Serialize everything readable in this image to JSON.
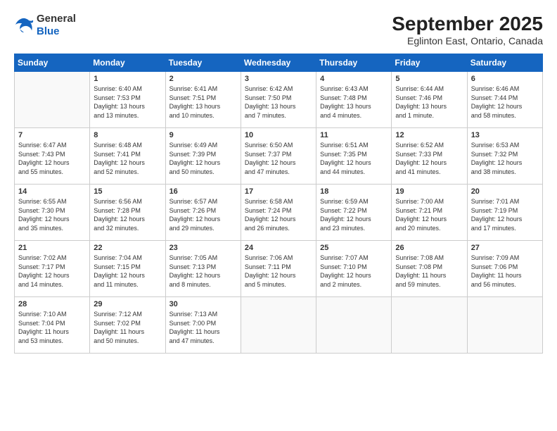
{
  "header": {
    "logo_general": "General",
    "logo_blue": "Blue",
    "title": "September 2025",
    "subtitle": "Eglinton East, Ontario, Canada"
  },
  "weekdays": [
    "Sunday",
    "Monday",
    "Tuesday",
    "Wednesday",
    "Thursday",
    "Friday",
    "Saturday"
  ],
  "weeks": [
    [
      {
        "day": "",
        "info": ""
      },
      {
        "day": "1",
        "info": "Sunrise: 6:40 AM\nSunset: 7:53 PM\nDaylight: 13 hours\nand 13 minutes."
      },
      {
        "day": "2",
        "info": "Sunrise: 6:41 AM\nSunset: 7:51 PM\nDaylight: 13 hours\nand 10 minutes."
      },
      {
        "day": "3",
        "info": "Sunrise: 6:42 AM\nSunset: 7:50 PM\nDaylight: 13 hours\nand 7 minutes."
      },
      {
        "day": "4",
        "info": "Sunrise: 6:43 AM\nSunset: 7:48 PM\nDaylight: 13 hours\nand 4 minutes."
      },
      {
        "day": "5",
        "info": "Sunrise: 6:44 AM\nSunset: 7:46 PM\nDaylight: 13 hours\nand 1 minute."
      },
      {
        "day": "6",
        "info": "Sunrise: 6:46 AM\nSunset: 7:44 PM\nDaylight: 12 hours\nand 58 minutes."
      }
    ],
    [
      {
        "day": "7",
        "info": "Sunrise: 6:47 AM\nSunset: 7:43 PM\nDaylight: 12 hours\nand 55 minutes."
      },
      {
        "day": "8",
        "info": "Sunrise: 6:48 AM\nSunset: 7:41 PM\nDaylight: 12 hours\nand 52 minutes."
      },
      {
        "day": "9",
        "info": "Sunrise: 6:49 AM\nSunset: 7:39 PM\nDaylight: 12 hours\nand 50 minutes."
      },
      {
        "day": "10",
        "info": "Sunrise: 6:50 AM\nSunset: 7:37 PM\nDaylight: 12 hours\nand 47 minutes."
      },
      {
        "day": "11",
        "info": "Sunrise: 6:51 AM\nSunset: 7:35 PM\nDaylight: 12 hours\nand 44 minutes."
      },
      {
        "day": "12",
        "info": "Sunrise: 6:52 AM\nSunset: 7:33 PM\nDaylight: 12 hours\nand 41 minutes."
      },
      {
        "day": "13",
        "info": "Sunrise: 6:53 AM\nSunset: 7:32 PM\nDaylight: 12 hours\nand 38 minutes."
      }
    ],
    [
      {
        "day": "14",
        "info": "Sunrise: 6:55 AM\nSunset: 7:30 PM\nDaylight: 12 hours\nand 35 minutes."
      },
      {
        "day": "15",
        "info": "Sunrise: 6:56 AM\nSunset: 7:28 PM\nDaylight: 12 hours\nand 32 minutes."
      },
      {
        "day": "16",
        "info": "Sunrise: 6:57 AM\nSunset: 7:26 PM\nDaylight: 12 hours\nand 29 minutes."
      },
      {
        "day": "17",
        "info": "Sunrise: 6:58 AM\nSunset: 7:24 PM\nDaylight: 12 hours\nand 26 minutes."
      },
      {
        "day": "18",
        "info": "Sunrise: 6:59 AM\nSunset: 7:22 PM\nDaylight: 12 hours\nand 23 minutes."
      },
      {
        "day": "19",
        "info": "Sunrise: 7:00 AM\nSunset: 7:21 PM\nDaylight: 12 hours\nand 20 minutes."
      },
      {
        "day": "20",
        "info": "Sunrise: 7:01 AM\nSunset: 7:19 PM\nDaylight: 12 hours\nand 17 minutes."
      }
    ],
    [
      {
        "day": "21",
        "info": "Sunrise: 7:02 AM\nSunset: 7:17 PM\nDaylight: 12 hours\nand 14 minutes."
      },
      {
        "day": "22",
        "info": "Sunrise: 7:04 AM\nSunset: 7:15 PM\nDaylight: 12 hours\nand 11 minutes."
      },
      {
        "day": "23",
        "info": "Sunrise: 7:05 AM\nSunset: 7:13 PM\nDaylight: 12 hours\nand 8 minutes."
      },
      {
        "day": "24",
        "info": "Sunrise: 7:06 AM\nSunset: 7:11 PM\nDaylight: 12 hours\nand 5 minutes."
      },
      {
        "day": "25",
        "info": "Sunrise: 7:07 AM\nSunset: 7:10 PM\nDaylight: 12 hours\nand 2 minutes."
      },
      {
        "day": "26",
        "info": "Sunrise: 7:08 AM\nSunset: 7:08 PM\nDaylight: 11 hours\nand 59 minutes."
      },
      {
        "day": "27",
        "info": "Sunrise: 7:09 AM\nSunset: 7:06 PM\nDaylight: 11 hours\nand 56 minutes."
      }
    ],
    [
      {
        "day": "28",
        "info": "Sunrise: 7:10 AM\nSunset: 7:04 PM\nDaylight: 11 hours\nand 53 minutes."
      },
      {
        "day": "29",
        "info": "Sunrise: 7:12 AM\nSunset: 7:02 PM\nDaylight: 11 hours\nand 50 minutes."
      },
      {
        "day": "30",
        "info": "Sunrise: 7:13 AM\nSunset: 7:00 PM\nDaylight: 11 hours\nand 47 minutes."
      },
      {
        "day": "",
        "info": ""
      },
      {
        "day": "",
        "info": ""
      },
      {
        "day": "",
        "info": ""
      },
      {
        "day": "",
        "info": ""
      }
    ]
  ]
}
